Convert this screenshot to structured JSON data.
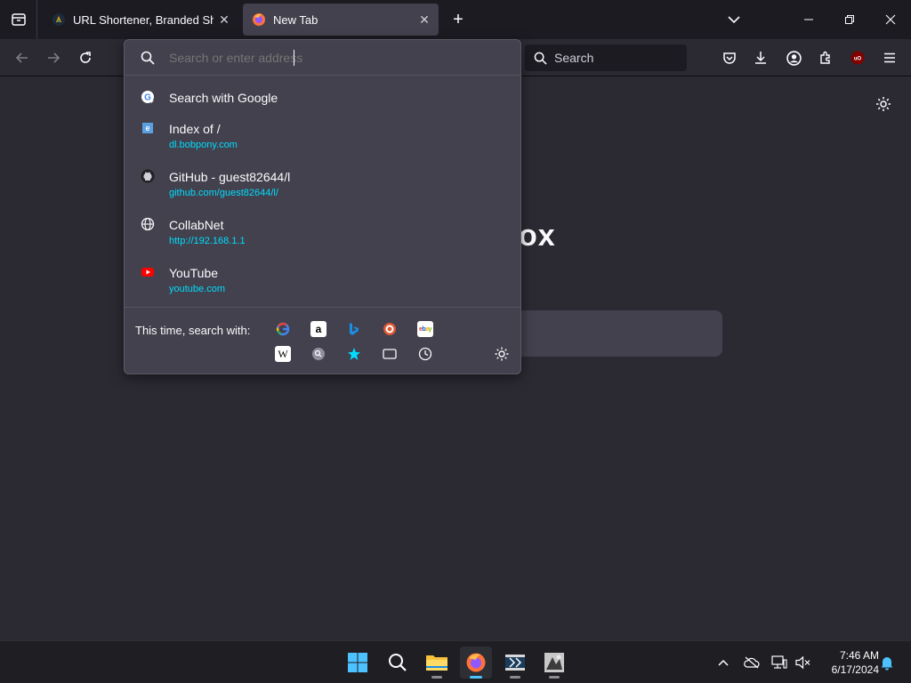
{
  "tabs": [
    {
      "title": "URL Shortener, Branded Short Links & Analytics",
      "icon": "bitly-favicon",
      "active": false
    },
    {
      "title": "New Tab",
      "icon": "firefox-logo",
      "active": true
    }
  ],
  "toolbar": {
    "search_label": "Search"
  },
  "urlbar": {
    "placeholder": "Search or enter address"
  },
  "results": [
    {
      "title": "Search with Google",
      "url": "",
      "icon": "google-icon"
    },
    {
      "title": "Index of /",
      "url": "dl.bobpony.com",
      "icon": "ie-page-icon"
    },
    {
      "title": "GitHub - guest82644/l",
      "url": "github.com/guest82644/l/",
      "icon": "github-icon"
    },
    {
      "title": "CollabNet",
      "url": "http://192.168.1.1",
      "icon": "globe-icon"
    },
    {
      "title": "YouTube",
      "url": "youtube.com",
      "icon": "youtube-icon"
    }
  ],
  "one_offs": {
    "label": "This time, search with:",
    "engines": [
      "google",
      "amazon",
      "bing",
      "duckduckgo",
      "ebay",
      "wikipedia",
      "search",
      "bookmarks",
      "tabs",
      "history"
    ]
  },
  "content": {
    "brand_fragment": "ox"
  },
  "taskbar": {
    "time": "7:46 AM",
    "date": "6/17/2024"
  },
  "colors": {
    "accent_link": "#00ddff",
    "panel_bg": "#42414d",
    "toolbar_bg": "#2b2a33",
    "tabstrip_bg": "#1c1b22"
  }
}
